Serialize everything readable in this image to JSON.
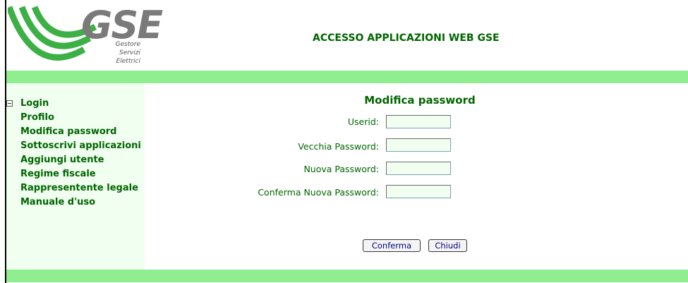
{
  "header": {
    "logo_text": "GSE",
    "logo_subtitle": [
      "Gestore",
      "Servizi",
      "Elettrici"
    ],
    "title": "ACCESSO APPLICAZIONI WEB GSE"
  },
  "sidebar": {
    "items": [
      {
        "label": "Login",
        "icon": "collapse-icon"
      },
      {
        "label": "Profilo"
      },
      {
        "label": "Modifica password"
      },
      {
        "label": "Sottoscrivi applicazioni"
      },
      {
        "label": "Aggiungi utente"
      },
      {
        "label": "Regime fiscale"
      },
      {
        "label": "Rappresentente legale"
      },
      {
        "label": "Manuale d'uso"
      }
    ]
  },
  "form": {
    "title": "Modifica password",
    "fields": [
      {
        "label": "Userid:",
        "value": ""
      },
      {
        "label": "Vecchia Password:",
        "value": ""
      },
      {
        "label": "Nuova Password:",
        "value": ""
      },
      {
        "label": "Conferma Nuova Password:",
        "value": ""
      }
    ],
    "confirm_label": "Conferma",
    "close_label": "Chiudi"
  },
  "colors": {
    "brand_green": "#3cb044",
    "text_green": "#006400",
    "bar_green": "#90ee90",
    "panel_green": "#f0fff0"
  }
}
